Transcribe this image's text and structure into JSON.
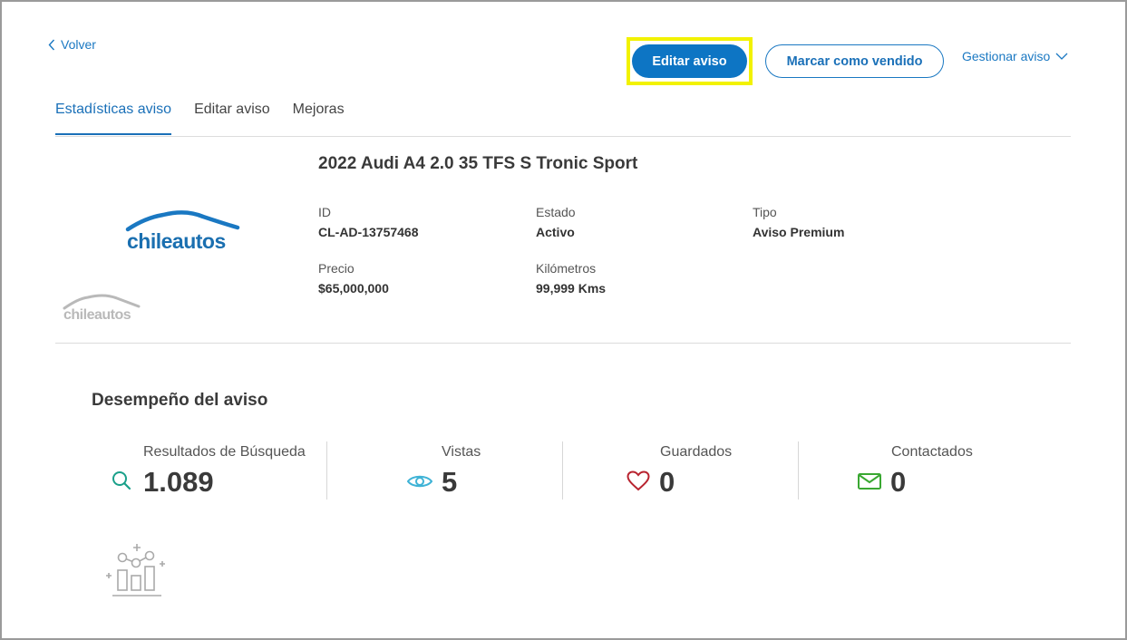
{
  "nav": {
    "back_label": "Volver"
  },
  "actions": {
    "edit_label": "Editar aviso",
    "mark_sold_label": "Marcar como vendido",
    "manage_label": "Gestionar aviso"
  },
  "tabs": [
    {
      "label": "Estadísticas aviso",
      "active": true
    },
    {
      "label": "Editar aviso",
      "active": false
    },
    {
      "label": "Mejoras",
      "active": false
    }
  ],
  "listing": {
    "title": "2022 Audi A4 2.0 35 TFS S Tronic Sport",
    "logo_text": "chileautos",
    "fields": {
      "id": {
        "label": "ID",
        "value": "CL-AD-13757468"
      },
      "estado": {
        "label": "Estado",
        "value": "Activo"
      },
      "tipo": {
        "label": "Tipo",
        "value": "Aviso Premium"
      },
      "precio": {
        "label": "Precio",
        "value": "$65,000,000"
      },
      "kilometros": {
        "label": "Kilómetros",
        "value": "99,999 Kms"
      }
    }
  },
  "performance": {
    "title": "Desempeño del aviso",
    "stats": [
      {
        "label": "Resultados de Búsqueda",
        "value": "1.089",
        "icon": "search-icon",
        "color": "#1aa08a"
      },
      {
        "label": "Vistas",
        "value": "5",
        "icon": "eye-icon",
        "color": "#3fb3d6"
      },
      {
        "label": "Guardados",
        "value": "0",
        "icon": "heart-icon",
        "color": "#b8232f"
      },
      {
        "label": "Contactados",
        "value": "0",
        "icon": "mail-icon",
        "color": "#3aa832"
      }
    ]
  },
  "colors": {
    "primary": "#0d75c4",
    "highlight": "#f2f200",
    "link": "#1a78c2"
  }
}
